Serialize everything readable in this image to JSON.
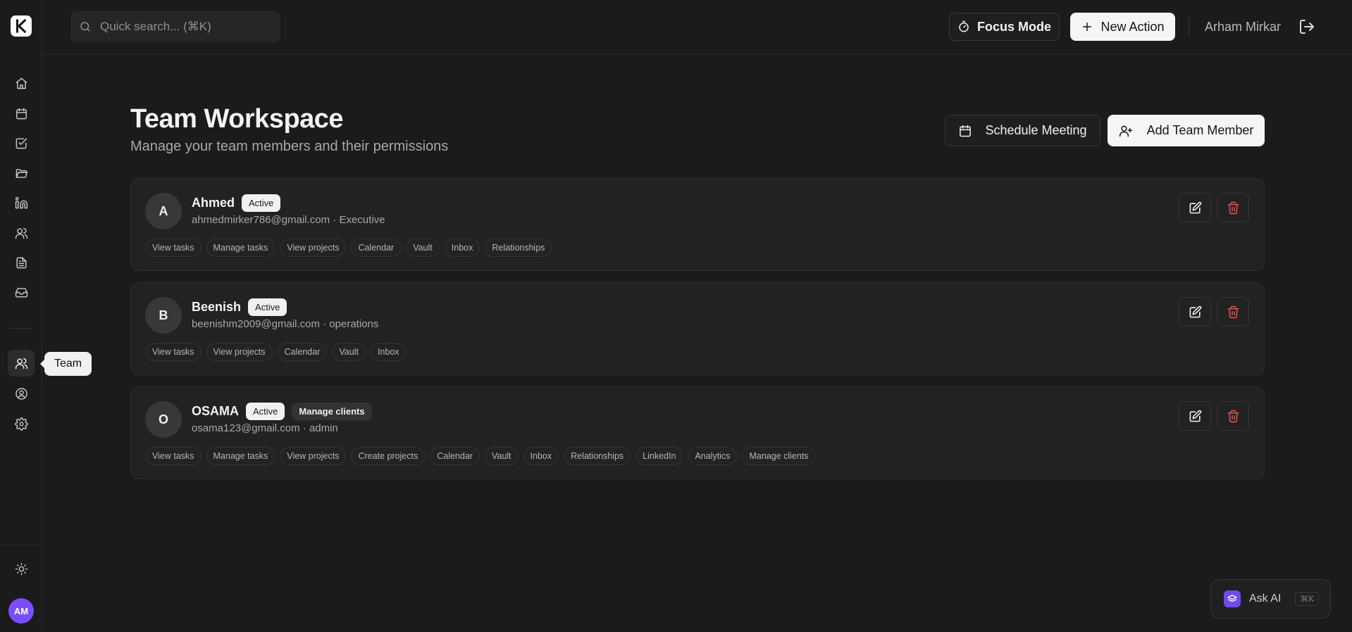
{
  "app": {
    "logo_letter": "K"
  },
  "sidebar": {
    "items": [
      {
        "name": "home",
        "icon": "home-icon"
      },
      {
        "name": "calendar",
        "icon": "calendar-icon"
      },
      {
        "name": "tasks",
        "icon": "checkbox-icon"
      },
      {
        "name": "projects",
        "icon": "folder-icon"
      },
      {
        "name": "linkedin",
        "icon": "linkedin-icon"
      },
      {
        "name": "relationships",
        "icon": "users-icon"
      },
      {
        "name": "documents",
        "icon": "document-icon"
      },
      {
        "name": "inbox",
        "icon": "inbox-icon"
      }
    ],
    "secondary": [
      {
        "name": "team",
        "icon": "users-icon",
        "active": true
      },
      {
        "name": "profile",
        "icon": "user-circle-icon"
      },
      {
        "name": "settings",
        "icon": "gear-icon"
      }
    ],
    "tooltip": "Team",
    "user_initials": "AM"
  },
  "topbar": {
    "search_placeholder": "Quick search... (⌘K)",
    "focus_mode_label": "Focus Mode",
    "new_action_label": "New Action",
    "user_name": "Arham Mirkar"
  },
  "page": {
    "title": "Team Workspace",
    "subtitle": "Manage your team members and their permissions",
    "schedule_label": "Schedule Meeting",
    "add_member_label": "Add Team Member"
  },
  "members": [
    {
      "initial": "A",
      "name": "Ahmed",
      "status": "Active",
      "role_badge": "",
      "email_line": "ahmedmirker786@gmail.com · Executive",
      "permissions": [
        "View tasks",
        "Manage tasks",
        "View projects",
        "Calendar",
        "Vault",
        "Inbox",
        "Relationships"
      ]
    },
    {
      "initial": "B",
      "name": "Beenish",
      "status": "Active",
      "role_badge": "",
      "email_line": "beenishm2009@gmail.com · operations",
      "permissions": [
        "View tasks",
        "View projects",
        "Calendar",
        "Vault",
        "Inbox"
      ]
    },
    {
      "initial": "O",
      "name": "OSAMA",
      "status": "Active",
      "role_badge": "Manage clients",
      "email_line": "osama123@gmail.com · admin",
      "permissions": [
        "View tasks",
        "Manage tasks",
        "View projects",
        "Create projects",
        "Calendar",
        "Vault",
        "Inbox",
        "Relationships",
        "LinkedIn",
        "Analytics",
        "Manage clients"
      ]
    }
  ],
  "ask_ai": {
    "label": "Ask AI",
    "shortcut": "⌘K"
  },
  "colors": {
    "accent": "#7c4dff",
    "danger": "#e05252",
    "background": "#1b1b1b"
  }
}
